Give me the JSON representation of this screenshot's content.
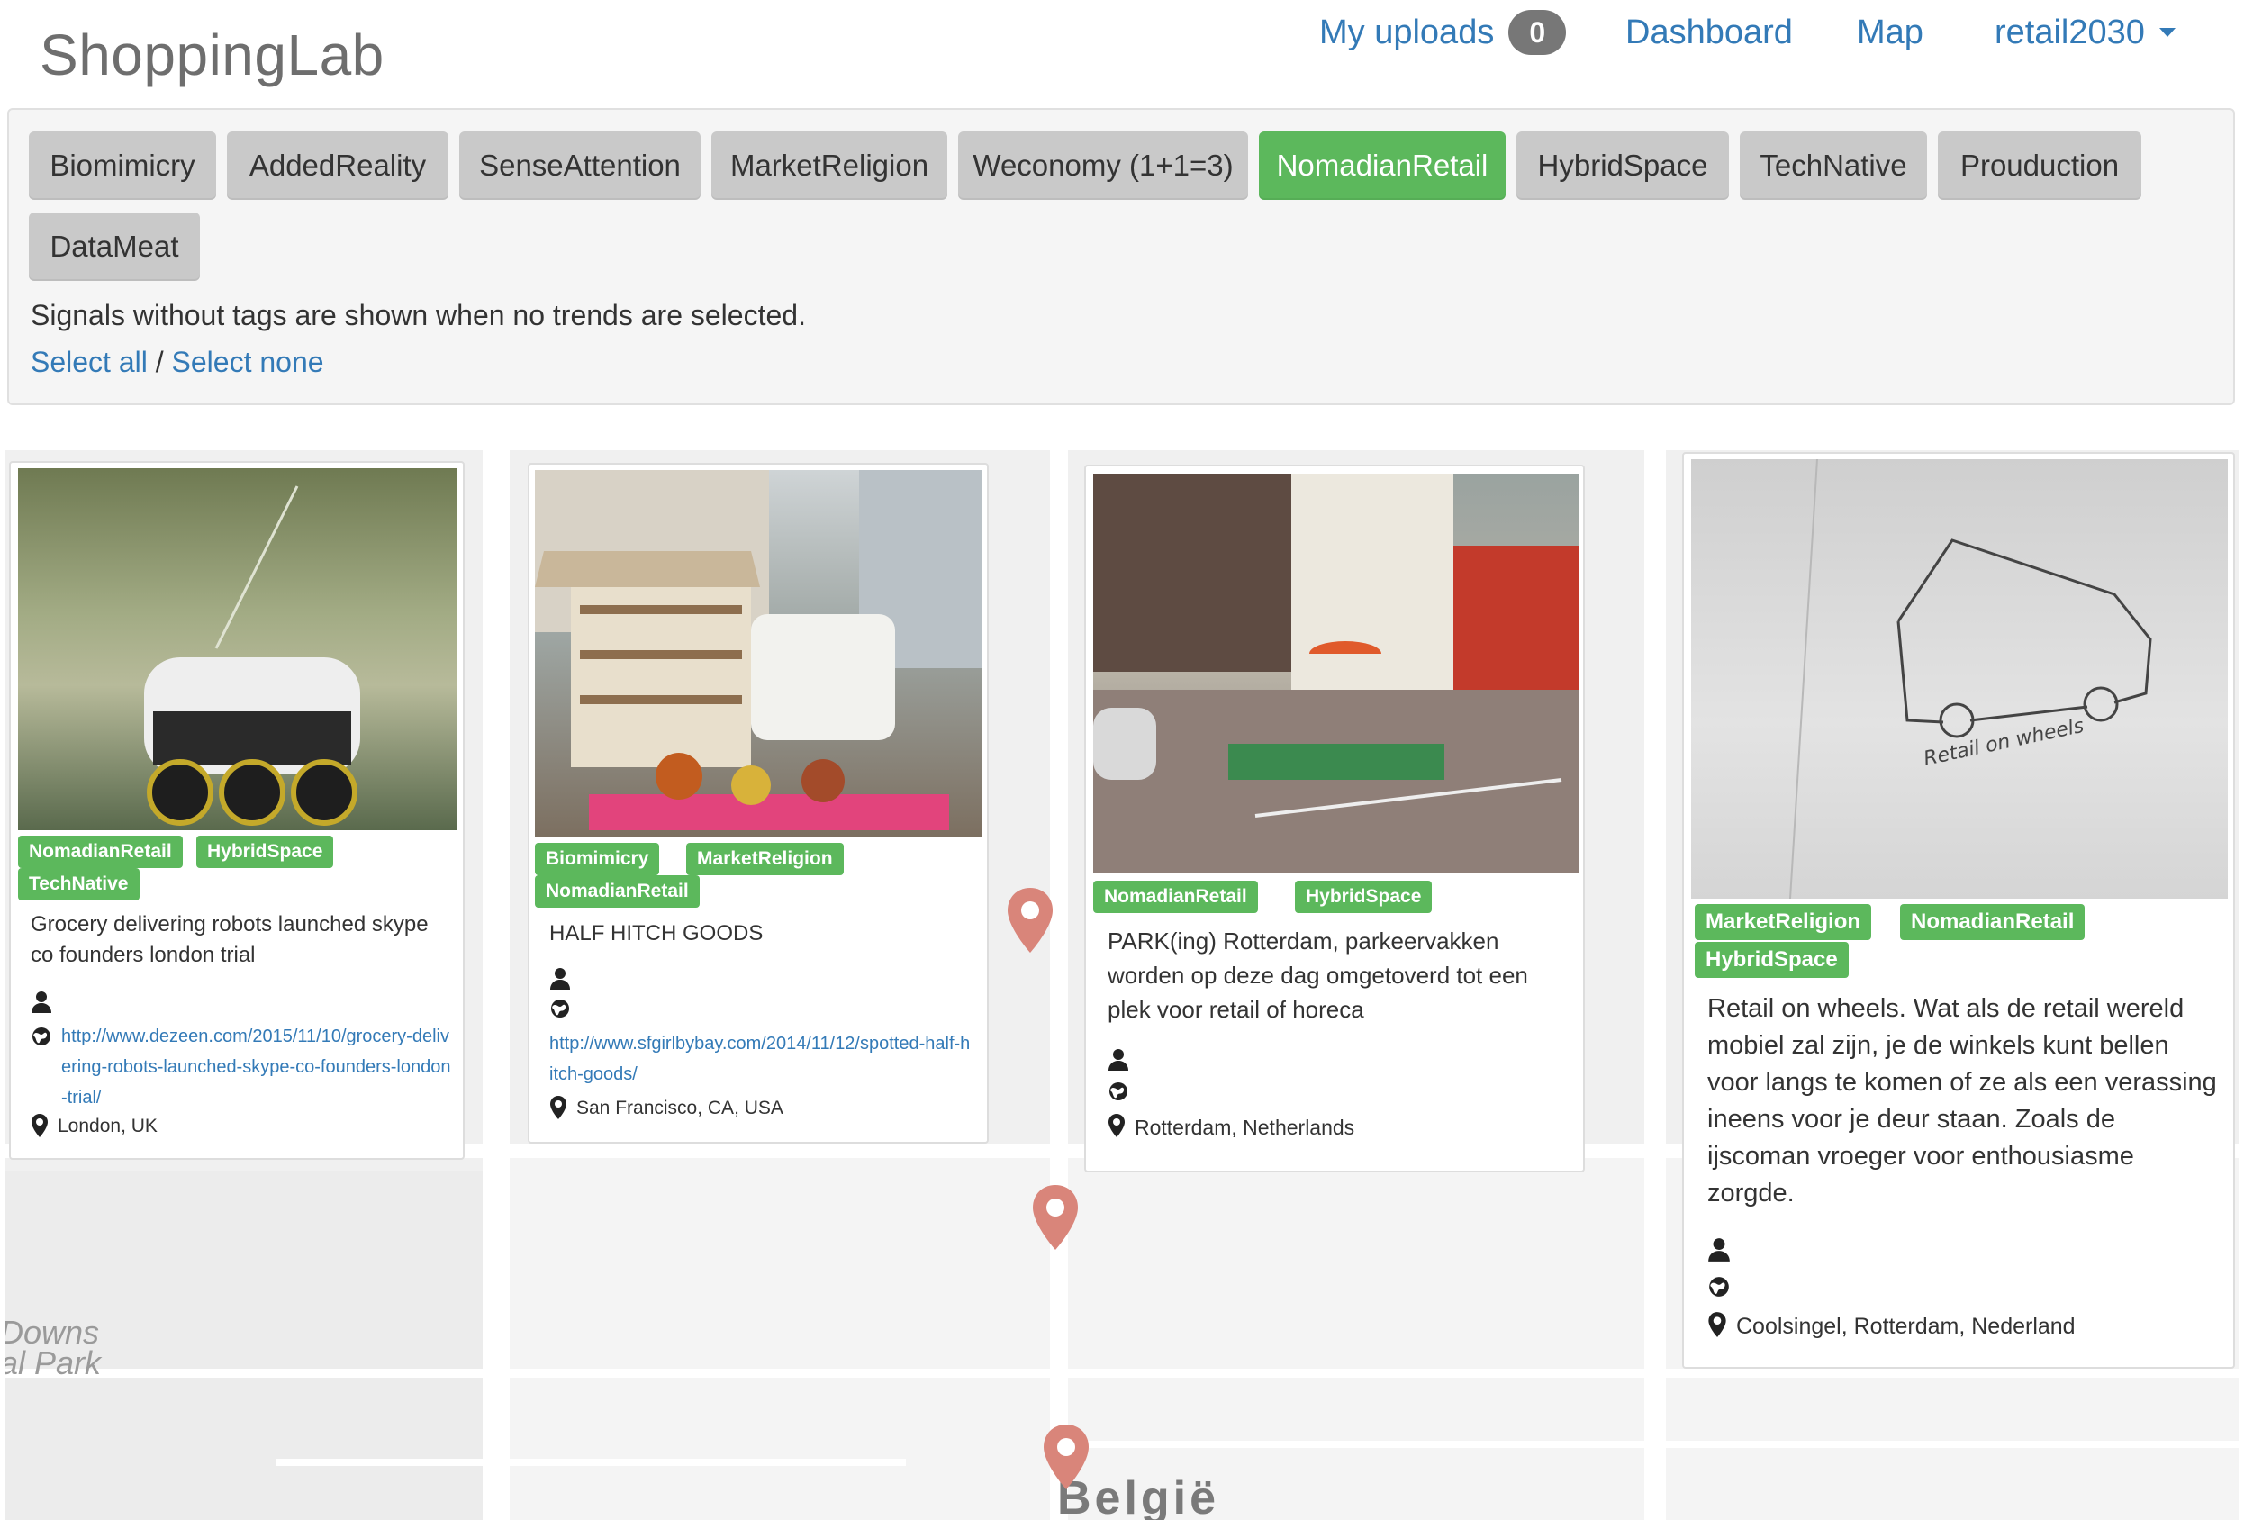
{
  "header": {
    "brand": "ShoppingLab",
    "my_uploads": "My uploads",
    "uploads_count": "0",
    "dashboard": "Dashboard",
    "map": "Map",
    "user": "retail2030"
  },
  "filters": {
    "tags": [
      {
        "label": "Biomimicry",
        "active": false
      },
      {
        "label": "AddedReality",
        "active": false
      },
      {
        "label": "SenseAttention",
        "active": false
      },
      {
        "label": "MarketReligion",
        "active": false
      },
      {
        "label": "Weconomy (1+1=3)",
        "active": false
      },
      {
        "label": "NomadianRetail",
        "active": true
      },
      {
        "label": "HybridSpace",
        "active": false
      },
      {
        "label": "TechNative",
        "active": false
      },
      {
        "label": "Prouduction",
        "active": false
      },
      {
        "label": "DataMeat",
        "active": false
      }
    ],
    "note": "Signals without tags are shown when no trends are selected.",
    "select_all": "Select all",
    "separator": " / ",
    "select_none": "Select none"
  },
  "map": {
    "labels": [
      "Downs",
      "al Park"
    ],
    "country": "België"
  },
  "colors": {
    "accent_green": "#5cb85c",
    "link_blue": "#337ab7",
    "button_grey": "#c9c9c9",
    "pin_color": "#d9857a"
  },
  "cards": [
    {
      "tags": [
        "NomadianRetail",
        "HybridSpace",
        "TechNative"
      ],
      "title": "Grocery delivering robots launched skype co founders london trial",
      "link": "http://www.dezeen.com/2015/11/10/grocery-delivering-robots-launched-skype-co-founders-london-trial/",
      "location": "London, UK"
    },
    {
      "tags": [
        "Biomimicry",
        "MarketReligion",
        "NomadianRetail"
      ],
      "title": "HALF HITCH GOODS",
      "link": "http://www.sfgirlbybay.com/2014/11/12/spotted-half-hitch-goods/",
      "location": "San Francisco, CA, USA"
    },
    {
      "tags": [
        "NomadianRetail",
        "HybridSpace"
      ],
      "title": "PARK(ing) Rotterdam, parkeervakken worden op deze dag omgetoverd tot een plek voor retail of horeca",
      "link": "",
      "location": "Rotterdam, Netherlands"
    },
    {
      "tags": [
        "MarketReligion",
        "NomadianRetail",
        "HybridSpace"
      ],
      "title": "Retail on wheels. Wat als de retail wereld mobiel zal zijn, je de winkels kunt bellen voor langs te komen of ze als een verassing ineens voor je deur staan. Zoals de ijscoman vroeger voor enthousiasme zorgde.",
      "link": "",
      "location": "Coolsingel, Rotterdam, Nederland",
      "sketch_caption": "Retail on wheels"
    }
  ]
}
